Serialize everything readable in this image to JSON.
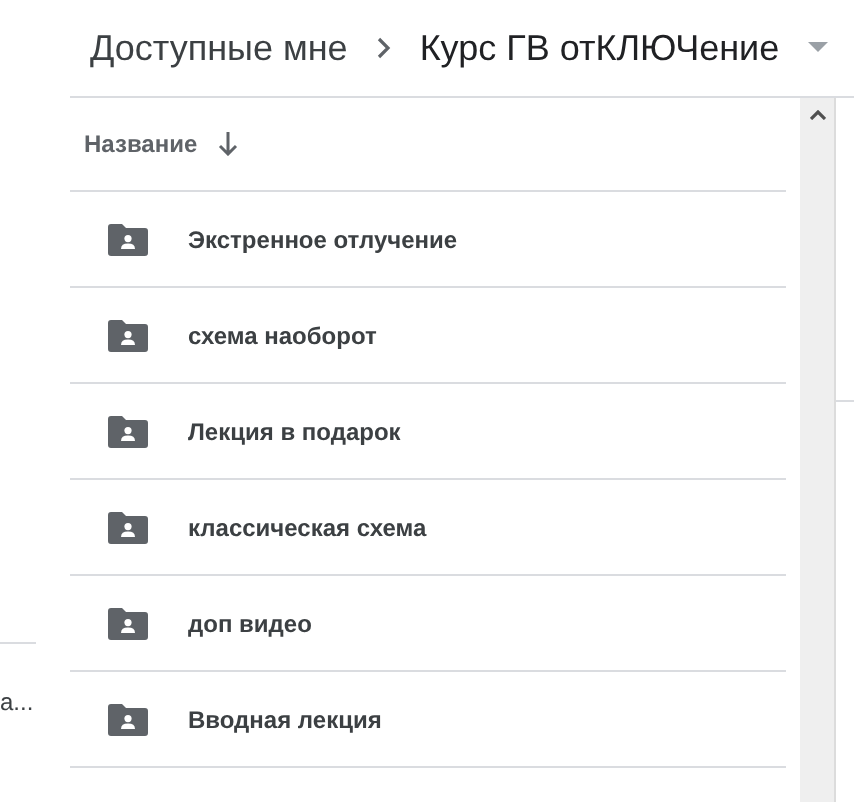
{
  "breadcrumb": [
    {
      "label": "Доступные мне"
    },
    {
      "label": "Курс ГВ отКЛЮЧение"
    }
  ],
  "side_text": "а...",
  "column_header": {
    "label": "Название",
    "sorted_descending": true
  },
  "rows": [
    {
      "name": "Экстренное отлучение"
    },
    {
      "name": "схема наоборот"
    },
    {
      "name": "Лекция в подарок"
    },
    {
      "name": "классическая схема"
    },
    {
      "name": "доп видео"
    },
    {
      "name": "Вводная лекция"
    }
  ]
}
